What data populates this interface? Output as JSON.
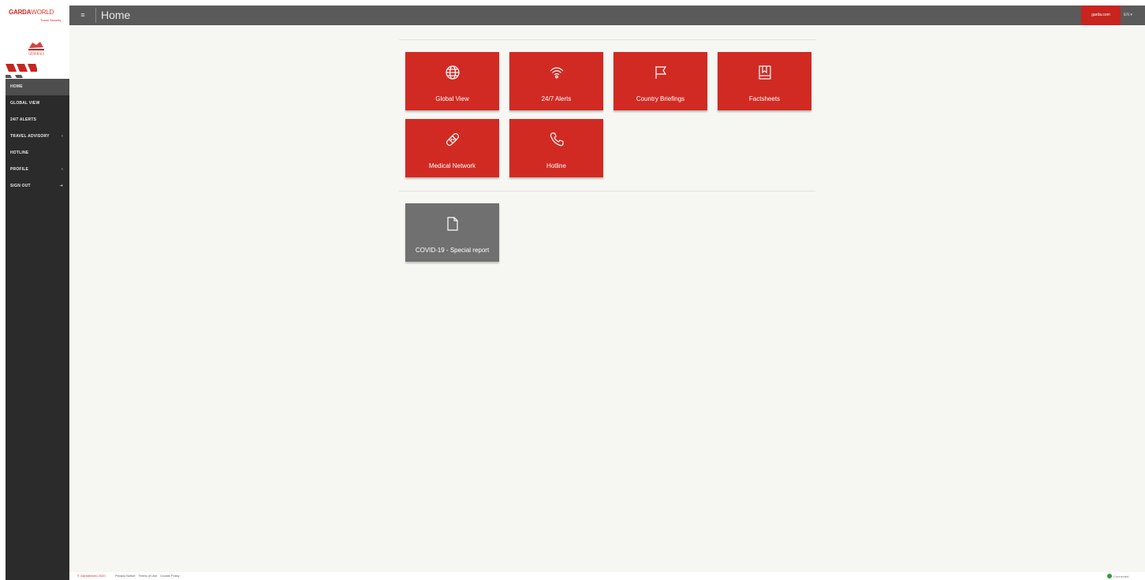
{
  "brand": {
    "garda": "GARDA",
    "world": "WORLD",
    "subtitle": "Travel Security",
    "partner": "GENERALI"
  },
  "sidebar": {
    "items": [
      {
        "label": "HOME",
        "active": true
      },
      {
        "label": "GLOBAL VIEW"
      },
      {
        "label": "24/7 ALERTS"
      },
      {
        "label": "TRAVEL ADVISORY",
        "arrow": "‹"
      },
      {
        "label": "HOTLINE"
      },
      {
        "label": "PROFILE",
        "arrow": "‹"
      },
      {
        "label": "SIGN OUT",
        "arrow": "➜"
      }
    ]
  },
  "topbar": {
    "menu_icon": "≡",
    "title": "Home",
    "red_link": "garda.com",
    "language": "EN ▾"
  },
  "tiles": [
    {
      "label": "Global View",
      "icon": "globe-icon"
    },
    {
      "label": "24/7 Alerts",
      "icon": "signal-icon"
    },
    {
      "label": "Country Briefings",
      "icon": "flag-icon"
    },
    {
      "label": "Factsheets",
      "icon": "book-icon"
    },
    {
      "label": "Medical Network",
      "icon": "bandage-icon"
    },
    {
      "label": "Hotline",
      "icon": "phone-icon"
    }
  ],
  "special": {
    "label": "COVID-19 - Special report",
    "icon": "document-icon"
  },
  "footer": {
    "copyright": "© GardaWorld 2020",
    "links": [
      "Privacy Notice",
      "Terms of Use",
      "Cookie Policy"
    ],
    "status": "Connected"
  },
  "colors": {
    "accent": "#d12a23",
    "sidebar": "#2b2b2b",
    "topbar": "#5a5a5a",
    "tile_grey": "#707070"
  }
}
